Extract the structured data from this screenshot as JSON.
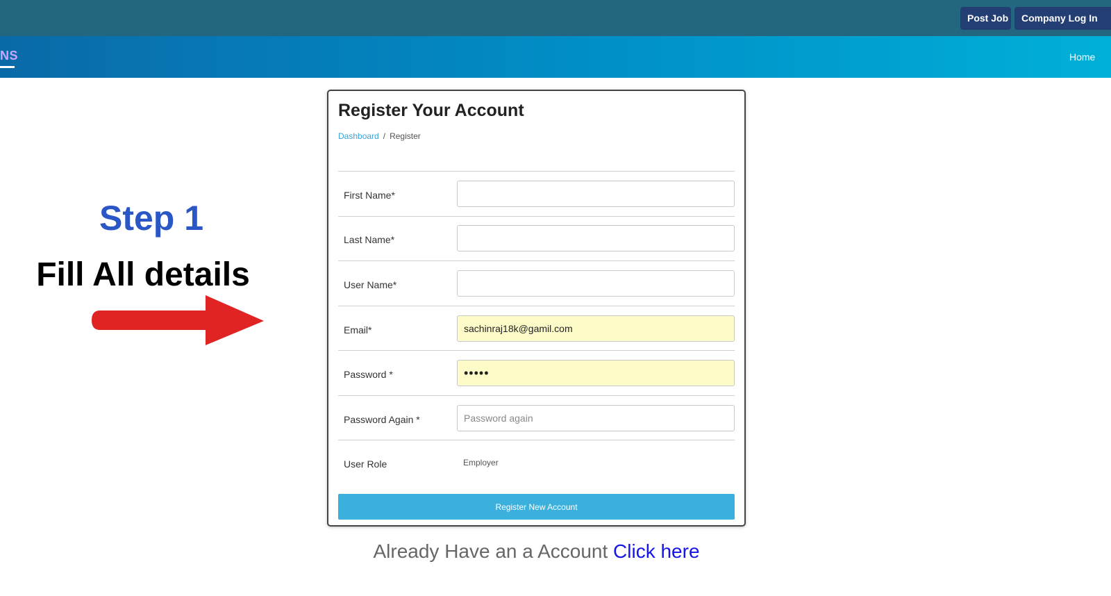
{
  "topbar": {
    "post_job": "Post Job",
    "company_login": "Company Log In"
  },
  "navbar": {
    "brand_fragment": "NS",
    "home": "Home"
  },
  "annotation": {
    "step": "Step 1",
    "instruction": "Fill All details",
    "arrow_color": "#e02424",
    "step_color": "#2a56c6"
  },
  "form": {
    "title": "Register Your Account",
    "breadcrumb": {
      "dashboard": "Dashboard",
      "separator": "/",
      "current": "Register"
    },
    "fields": [
      {
        "label": "First Name*",
        "value": "",
        "placeholder": ""
      },
      {
        "label": "Last Name*",
        "value": "",
        "placeholder": ""
      },
      {
        "label": "User Name*",
        "value": "",
        "placeholder": ""
      },
      {
        "label": "Email*",
        "value": "sachinraj18k@gamil.com",
        "placeholder": ""
      },
      {
        "label": "Password *",
        "value": "•••••",
        "placeholder": ""
      },
      {
        "label": "Password Again *",
        "value": "",
        "placeholder": "Password again"
      }
    ],
    "role": {
      "label": "User Role",
      "value": "Employer"
    },
    "submit": "Register New Account"
  },
  "footer": {
    "text": "Already Have an a Account",
    "link": "Click here"
  },
  "colors": {
    "topbar": "#236680",
    "button_dark": "#233e72",
    "submit": "#3cb0dc",
    "autofill": "#fdfcc8",
    "link": "#1515e6"
  }
}
